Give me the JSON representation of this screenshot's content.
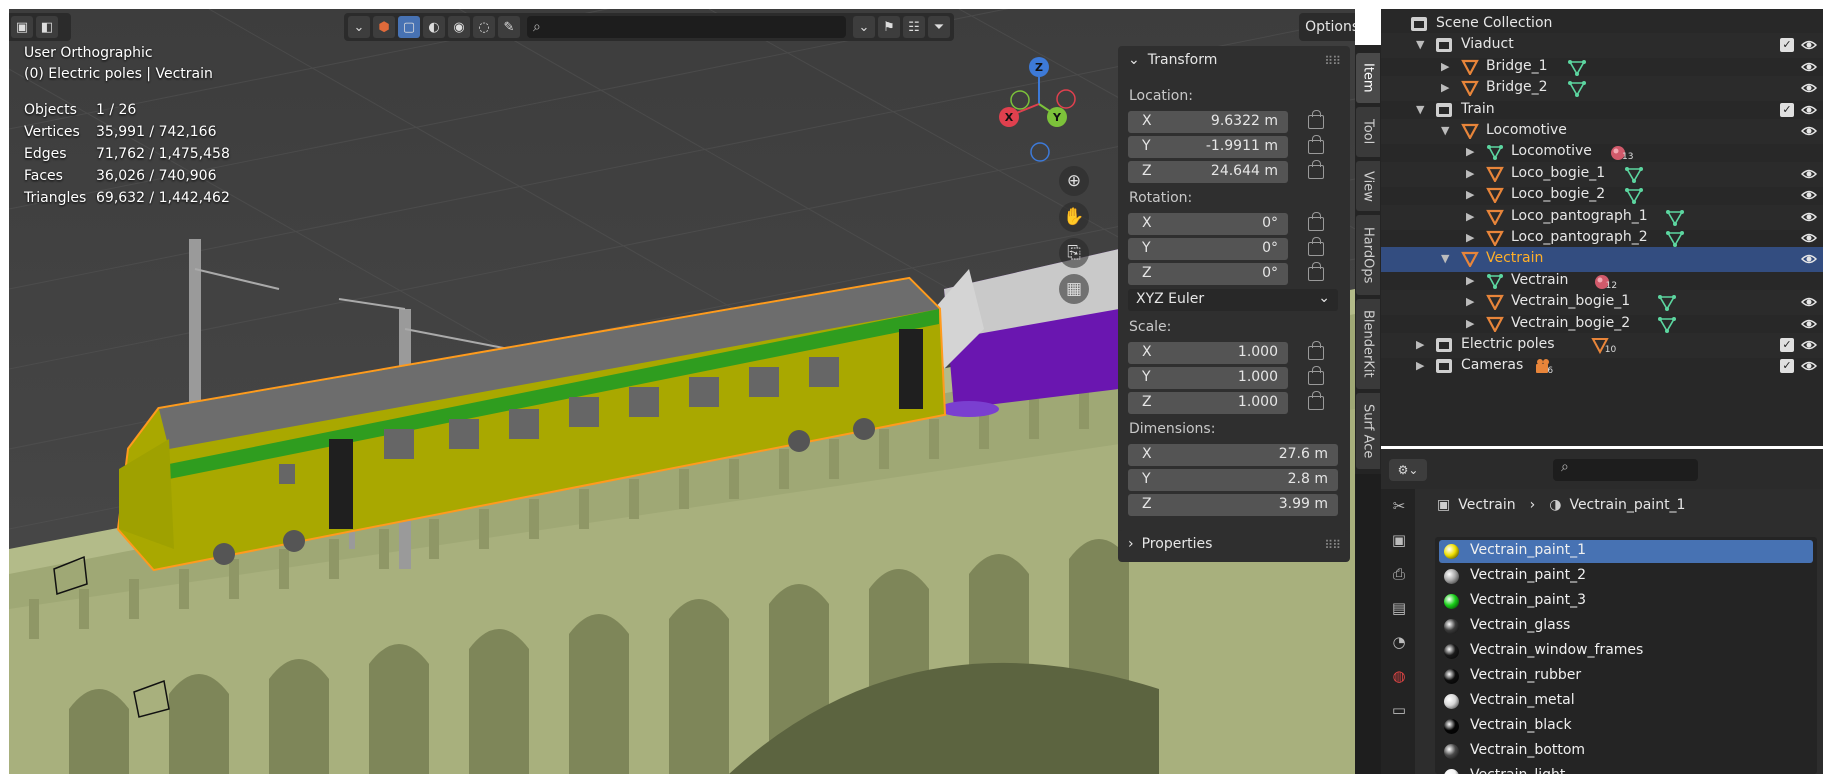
{
  "viewport": {
    "view_name": "User Orthographic",
    "context": "(0) Electric poles | Vectrain",
    "stats": [
      {
        "label": "Objects",
        "value": "1 / 26"
      },
      {
        "label": "Vertices",
        "value": "35,991 / 742,166"
      },
      {
        "label": "Edges",
        "value": "71,762 / 1,475,458"
      },
      {
        "label": "Faces",
        "value": "36,026 / 740,906"
      },
      {
        "label": "Triangles",
        "value": "69,632 / 1,442,462"
      }
    ],
    "options_label": "Options",
    "gizmo": {
      "x": "X",
      "y": "Y",
      "z": "Z"
    }
  },
  "transform_panel": {
    "title": "Transform",
    "location_label": "Location:",
    "location": [
      {
        "axis": "X",
        "value": "9.6322 m"
      },
      {
        "axis": "Y",
        "value": "-1.9911 m"
      },
      {
        "axis": "Z",
        "value": "24.644 m"
      }
    ],
    "rotation_label": "Rotation:",
    "rotation": [
      {
        "axis": "X",
        "value": "0°"
      },
      {
        "axis": "Y",
        "value": "0°"
      },
      {
        "axis": "Z",
        "value": "0°"
      }
    ],
    "rotation_mode": "XYZ Euler",
    "scale_label": "Scale:",
    "scale": [
      {
        "axis": "X",
        "value": "1.000"
      },
      {
        "axis": "Y",
        "value": "1.000"
      },
      {
        "axis": "Z",
        "value": "1.000"
      }
    ],
    "dimensions_label": "Dimensions:",
    "dimensions": [
      {
        "axis": "X",
        "value": "27.6 m"
      },
      {
        "axis": "Y",
        "value": "2.8 m"
      },
      {
        "axis": "Z",
        "value": "3.99 m"
      }
    ],
    "properties_title": "Properties"
  },
  "sidebar_tabs": [
    "Item",
    "Tool",
    "View",
    "HardOps",
    "BlenderKit",
    "Surf Ace"
  ],
  "outliner": {
    "rows": [
      {
        "label": "Scene Collection",
        "type": "scene",
        "depth": 0,
        "arrow": "",
        "check": false,
        "eye": false
      },
      {
        "label": "Viaduct",
        "type": "collection",
        "depth": 1,
        "arrow": "▼",
        "check": true,
        "eye": true
      },
      {
        "label": "Bridge_1",
        "type": "object",
        "depth": 2,
        "arrow": "▶",
        "check": false,
        "eye": true,
        "extra": "mesh"
      },
      {
        "label": "Bridge_2",
        "type": "object",
        "depth": 2,
        "arrow": "▶",
        "check": false,
        "eye": true,
        "extra": "mesh"
      },
      {
        "label": "Train",
        "type": "collection",
        "depth": 1,
        "arrow": "▼",
        "check": true,
        "eye": true
      },
      {
        "label": "Locomotive",
        "type": "object",
        "depth": 2,
        "arrow": "▼",
        "check": false,
        "eye": true
      },
      {
        "label": "Locomotive",
        "type": "mesh",
        "depth": 3,
        "arrow": "▶",
        "check": false,
        "eye": false,
        "extra": "material",
        "count": "13"
      },
      {
        "label": "Loco_bogie_1",
        "type": "object",
        "depth": 3,
        "arrow": "▶",
        "check": false,
        "eye": true,
        "extra": "mesh"
      },
      {
        "label": "Loco_bogie_2",
        "type": "object",
        "depth": 3,
        "arrow": "▶",
        "check": false,
        "eye": true,
        "extra": "mesh"
      },
      {
        "label": "Loco_pantograph_1",
        "type": "object",
        "depth": 3,
        "arrow": "▶",
        "check": false,
        "eye": true,
        "extra": "mesh"
      },
      {
        "label": "Loco_pantograph_2",
        "type": "object",
        "depth": 3,
        "arrow": "▶",
        "check": false,
        "eye": true,
        "extra": "mesh"
      },
      {
        "label": "Vectrain",
        "type": "object",
        "depth": 2,
        "arrow": "▼",
        "check": false,
        "eye": true,
        "selected": true
      },
      {
        "label": "Vectrain",
        "type": "mesh",
        "depth": 3,
        "arrow": "▶",
        "check": false,
        "eye": false,
        "extra": "material",
        "count": "12"
      },
      {
        "label": "Vectrain_bogie_1",
        "type": "object",
        "depth": 3,
        "arrow": "▶",
        "check": false,
        "eye": true,
        "extra": "mesh"
      },
      {
        "label": "Vectrain_bogie_2",
        "type": "object",
        "depth": 3,
        "arrow": "▶",
        "check": false,
        "eye": true,
        "extra": "mesh"
      },
      {
        "label": "Electric poles",
        "type": "collection",
        "depth": 1,
        "arrow": "▶",
        "check": true,
        "eye": true,
        "extra": "objects",
        "count": "10"
      },
      {
        "label": "Cameras",
        "type": "collection",
        "depth": 1,
        "arrow": "▶",
        "check": true,
        "eye": true,
        "extra": "camera",
        "count": "6"
      }
    ]
  },
  "properties": {
    "breadcrumb": {
      "object": "Vectrain",
      "material": "Vectrain_paint_1"
    },
    "materials": [
      {
        "name": "Vectrain_paint_1",
        "color": "#f0e000",
        "selected": true
      },
      {
        "name": "Vectrain_paint_2",
        "color": "#a8a8a8"
      },
      {
        "name": "Vectrain_paint_3",
        "color": "#18d018"
      },
      {
        "name": "Vectrain_glass",
        "color": "#3c3c3c"
      },
      {
        "name": "Vectrain_window_frames",
        "color": "#1a1a1a"
      },
      {
        "name": "Vectrain_rubber",
        "color": "#0e0e0e"
      },
      {
        "name": "Vectrain_metal",
        "color": "#d8d8d8"
      },
      {
        "name": "Vectrain_black",
        "color": "#050505"
      },
      {
        "name": "Vectrain_bottom",
        "color": "#4a4a4a"
      },
      {
        "name": "Vectrain_light",
        "color": "#f4f4f4"
      }
    ]
  },
  "colors": {
    "selection_outline": "#ff9a1e",
    "active_row": "#334d80",
    "accent_blue": "#4772b3",
    "object_orange": "#e8853a",
    "mesh_green": "#5cd6a0",
    "train_body": "#a9a800",
    "train_stripe": "#2f9d1f",
    "bridge": "#a7b07c"
  }
}
